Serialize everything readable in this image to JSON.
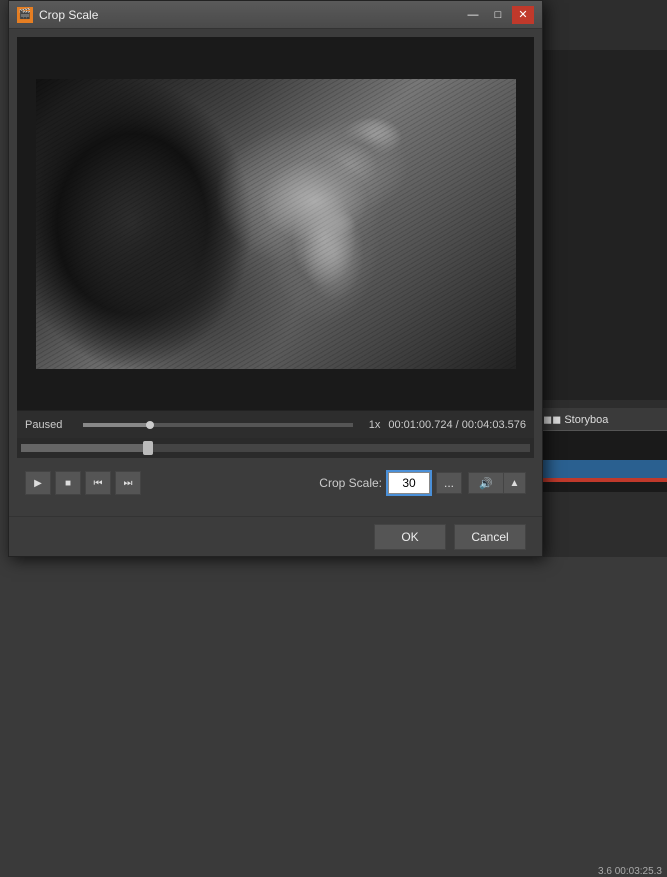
{
  "window": {
    "title": "Crop Scale",
    "app_icon": "🎬"
  },
  "controls": {
    "status": "Paused",
    "speed": "1x",
    "timecode_current": "00:01:00.724",
    "timecode_total": "00:04:03.576",
    "timecode_separator": " / ",
    "progress_percent": 25
  },
  "crop_scale": {
    "label": "Crop Scale:",
    "value": "30"
  },
  "playback": {
    "play_icon": "▶",
    "stop_icon": "■",
    "prev_icon": "⏮",
    "next_icon": "⏭"
  },
  "buttons": {
    "ok_label": "OK",
    "cancel_label": "Cancel",
    "dots_label": "...",
    "volume_icon": "🔊",
    "volume_up": "▲"
  },
  "background": {
    "storyboard_label": "◼◼ Storyboa",
    "bg_timecode": "3.6    00:03:25.3"
  }
}
